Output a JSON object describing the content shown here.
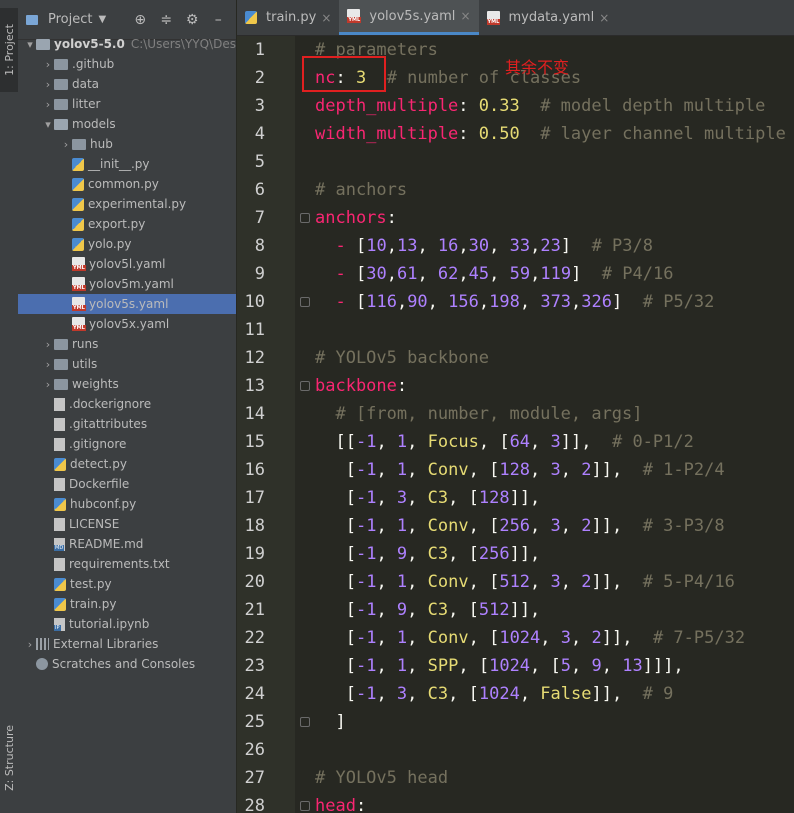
{
  "side_strip": {
    "project_tab": "1: Project",
    "structure_tab": "Z: Structure"
  },
  "panel": {
    "title": "Project"
  },
  "tree": [
    {
      "depth": 0,
      "arrow": "▾",
      "icon": "folder open",
      "label": "yolov5-5.0",
      "bold": true,
      "extra": "C:\\Users\\YYQ\\Des"
    },
    {
      "depth": 1,
      "arrow": "›",
      "icon": "folder",
      "label": ".github"
    },
    {
      "depth": 1,
      "arrow": "›",
      "icon": "folder",
      "label": "data"
    },
    {
      "depth": 1,
      "arrow": "›",
      "icon": "folder",
      "label": "litter"
    },
    {
      "depth": 1,
      "arrow": "▾",
      "icon": "folder open",
      "label": "models"
    },
    {
      "depth": 2,
      "arrow": "›",
      "icon": "folder",
      "label": "hub"
    },
    {
      "depth": 2,
      "arrow": "",
      "icon": "py",
      "label": "__init__.py"
    },
    {
      "depth": 2,
      "arrow": "",
      "icon": "py",
      "label": "common.py"
    },
    {
      "depth": 2,
      "arrow": "",
      "icon": "py",
      "label": "experimental.py"
    },
    {
      "depth": 2,
      "arrow": "",
      "icon": "py",
      "label": "export.py"
    },
    {
      "depth": 2,
      "arrow": "",
      "icon": "py",
      "label": "yolo.py"
    },
    {
      "depth": 2,
      "arrow": "",
      "icon": "yml",
      "label": "yolov5l.yaml"
    },
    {
      "depth": 2,
      "arrow": "",
      "icon": "yml",
      "label": "yolov5m.yaml"
    },
    {
      "depth": 2,
      "arrow": "",
      "icon": "yml",
      "label": "yolov5s.yaml",
      "selected": true
    },
    {
      "depth": 2,
      "arrow": "",
      "icon": "yml",
      "label": "yolov5x.yaml"
    },
    {
      "depth": 1,
      "arrow": "›",
      "icon": "folder",
      "label": "runs"
    },
    {
      "depth": 1,
      "arrow": "›",
      "icon": "folder",
      "label": "utils"
    },
    {
      "depth": 1,
      "arrow": "›",
      "icon": "folder",
      "label": "weights"
    },
    {
      "depth": 1,
      "arrow": "",
      "icon": "txt",
      "label": ".dockerignore"
    },
    {
      "depth": 1,
      "arrow": "",
      "icon": "txt",
      "label": ".gitattributes"
    },
    {
      "depth": 1,
      "arrow": "",
      "icon": "txt",
      "label": ".gitignore"
    },
    {
      "depth": 1,
      "arrow": "",
      "icon": "py",
      "label": "detect.py"
    },
    {
      "depth": 1,
      "arrow": "",
      "icon": "docker",
      "label": "Dockerfile"
    },
    {
      "depth": 1,
      "arrow": "",
      "icon": "py",
      "label": "hubconf.py"
    },
    {
      "depth": 1,
      "arrow": "",
      "icon": "txt",
      "label": "LICENSE"
    },
    {
      "depth": 1,
      "arrow": "",
      "icon": "md",
      "label": "README.md"
    },
    {
      "depth": 1,
      "arrow": "",
      "icon": "txt",
      "label": "requirements.txt"
    },
    {
      "depth": 1,
      "arrow": "",
      "icon": "py",
      "label": "test.py"
    },
    {
      "depth": 1,
      "arrow": "",
      "icon": "py",
      "label": "train.py"
    },
    {
      "depth": 1,
      "arrow": "",
      "icon": "nb",
      "label": "tutorial.ipynb"
    },
    {
      "depth": 0,
      "arrow": "›",
      "icon": "lib",
      "label": "External Libraries"
    },
    {
      "depth": 0,
      "arrow": "",
      "icon": "scratch",
      "label": "Scratches and Consoles"
    }
  ],
  "tabs": [
    {
      "label": "train.py",
      "icon": "py",
      "active": false
    },
    {
      "label": "yolov5s.yaml",
      "icon": "yml",
      "active": true
    },
    {
      "label": "mydata.yaml",
      "icon": "yml",
      "active": false
    }
  ],
  "annotation": "其余不变",
  "code_lines": [
    [
      [
        "c",
        "# parameters"
      ]
    ],
    [
      [
        "k",
        "nc"
      ],
      [
        "w",
        ": "
      ],
      [
        "num",
        "3"
      ],
      [
        "c",
        "  # number of classes"
      ]
    ],
    [
      [
        "k",
        "depth_multiple"
      ],
      [
        "w",
        ": "
      ],
      [
        "num",
        "0.33"
      ],
      [
        "c",
        "  # model depth multiple"
      ]
    ],
    [
      [
        "k",
        "width_multiple"
      ],
      [
        "w",
        ": "
      ],
      [
        "num",
        "0.50"
      ],
      [
        "c",
        "  # layer channel multiple"
      ]
    ],
    [],
    [
      [
        "c",
        "# anchors"
      ]
    ],
    [
      [
        "k",
        "anchors"
      ],
      [
        "w",
        ":"
      ]
    ],
    [
      [
        "w",
        "  "
      ],
      [
        "k",
        "-"
      ],
      [
        "w",
        " ["
      ],
      [
        "lit",
        "10"
      ],
      [
        "w",
        ","
      ],
      [
        "lit",
        "13"
      ],
      [
        "w",
        ", "
      ],
      [
        "lit",
        "16"
      ],
      [
        "w",
        ","
      ],
      [
        "lit",
        "30"
      ],
      [
        "w",
        ", "
      ],
      [
        "lit",
        "33"
      ],
      [
        "w",
        ","
      ],
      [
        "lit",
        "23"
      ],
      [
        "w",
        "]  "
      ],
      [
        "c",
        "# P3/8"
      ]
    ],
    [
      [
        "w",
        "  "
      ],
      [
        "k",
        "-"
      ],
      [
        "w",
        " ["
      ],
      [
        "lit",
        "30"
      ],
      [
        "w",
        ","
      ],
      [
        "lit",
        "61"
      ],
      [
        "w",
        ", "
      ],
      [
        "lit",
        "62"
      ],
      [
        "w",
        ","
      ],
      [
        "lit",
        "45"
      ],
      [
        "w",
        ", "
      ],
      [
        "lit",
        "59"
      ],
      [
        "w",
        ","
      ],
      [
        "lit",
        "119"
      ],
      [
        "w",
        "]  "
      ],
      [
        "c",
        "# P4/16"
      ]
    ],
    [
      [
        "w",
        "  "
      ],
      [
        "k",
        "-"
      ],
      [
        "w",
        " ["
      ],
      [
        "lit",
        "116"
      ],
      [
        "w",
        ","
      ],
      [
        "lit",
        "90"
      ],
      [
        "w",
        ", "
      ],
      [
        "lit",
        "156"
      ],
      [
        "w",
        ","
      ],
      [
        "lit",
        "198"
      ],
      [
        "w",
        ", "
      ],
      [
        "lit",
        "373"
      ],
      [
        "w",
        ","
      ],
      [
        "lit",
        "326"
      ],
      [
        "w",
        "]  "
      ],
      [
        "c",
        "# P5/32"
      ]
    ],
    [],
    [
      [
        "c",
        "# YOLOv5 backbone"
      ]
    ],
    [
      [
        "k",
        "backbone"
      ],
      [
        "w",
        ":"
      ]
    ],
    [
      [
        "c",
        "  # [from, number, module, args]"
      ]
    ],
    [
      [
        "w",
        "  [["
      ],
      [
        "lit",
        "-1"
      ],
      [
        "w",
        ", "
      ],
      [
        "lit",
        "1"
      ],
      [
        "w",
        ", "
      ],
      [
        "n",
        "Focus"
      ],
      [
        "w",
        ", ["
      ],
      [
        "lit",
        "64"
      ],
      [
        "w",
        ", "
      ],
      [
        "lit",
        "3"
      ],
      [
        "w",
        "]],  "
      ],
      [
        "c",
        "# 0-P1/2"
      ]
    ],
    [
      [
        "w",
        "   ["
      ],
      [
        "lit",
        "-1"
      ],
      [
        "w",
        ", "
      ],
      [
        "lit",
        "1"
      ],
      [
        "w",
        ", "
      ],
      [
        "n",
        "Conv"
      ],
      [
        "w",
        ", ["
      ],
      [
        "lit",
        "128"
      ],
      [
        "w",
        ", "
      ],
      [
        "lit",
        "3"
      ],
      [
        "w",
        ", "
      ],
      [
        "lit",
        "2"
      ],
      [
        "w",
        "]],  "
      ],
      [
        "c",
        "# 1-P2/4"
      ]
    ],
    [
      [
        "w",
        "   ["
      ],
      [
        "lit",
        "-1"
      ],
      [
        "w",
        ", "
      ],
      [
        "lit",
        "3"
      ],
      [
        "w",
        ", "
      ],
      [
        "n",
        "C3"
      ],
      [
        "w",
        ", ["
      ],
      [
        "lit",
        "128"
      ],
      [
        "w",
        "]],"
      ]
    ],
    [
      [
        "w",
        "   ["
      ],
      [
        "lit",
        "-1"
      ],
      [
        "w",
        ", "
      ],
      [
        "lit",
        "1"
      ],
      [
        "w",
        ", "
      ],
      [
        "n",
        "Conv"
      ],
      [
        "w",
        ", ["
      ],
      [
        "lit",
        "256"
      ],
      [
        "w",
        ", "
      ],
      [
        "lit",
        "3"
      ],
      [
        "w",
        ", "
      ],
      [
        "lit",
        "2"
      ],
      [
        "w",
        "]],  "
      ],
      [
        "c",
        "# 3-P3/8"
      ]
    ],
    [
      [
        "w",
        "   ["
      ],
      [
        "lit",
        "-1"
      ],
      [
        "w",
        ", "
      ],
      [
        "lit",
        "9"
      ],
      [
        "w",
        ", "
      ],
      [
        "n",
        "C3"
      ],
      [
        "w",
        ", ["
      ],
      [
        "lit",
        "256"
      ],
      [
        "w",
        "]],"
      ]
    ],
    [
      [
        "w",
        "   ["
      ],
      [
        "lit",
        "-1"
      ],
      [
        "w",
        ", "
      ],
      [
        "lit",
        "1"
      ],
      [
        "w",
        ", "
      ],
      [
        "n",
        "Conv"
      ],
      [
        "w",
        ", ["
      ],
      [
        "lit",
        "512"
      ],
      [
        "w",
        ", "
      ],
      [
        "lit",
        "3"
      ],
      [
        "w",
        ", "
      ],
      [
        "lit",
        "2"
      ],
      [
        "w",
        "]],  "
      ],
      [
        "c",
        "# 5-P4/16"
      ]
    ],
    [
      [
        "w",
        "   ["
      ],
      [
        "lit",
        "-1"
      ],
      [
        "w",
        ", "
      ],
      [
        "lit",
        "9"
      ],
      [
        "w",
        ", "
      ],
      [
        "n",
        "C3"
      ],
      [
        "w",
        ", ["
      ],
      [
        "lit",
        "512"
      ],
      [
        "w",
        "]],"
      ]
    ],
    [
      [
        "w",
        "   ["
      ],
      [
        "lit",
        "-1"
      ],
      [
        "w",
        ", "
      ],
      [
        "lit",
        "1"
      ],
      [
        "w",
        ", "
      ],
      [
        "n",
        "Conv"
      ],
      [
        "w",
        ", ["
      ],
      [
        "lit",
        "1024"
      ],
      [
        "w",
        ", "
      ],
      [
        "lit",
        "3"
      ],
      [
        "w",
        ", "
      ],
      [
        "lit",
        "2"
      ],
      [
        "w",
        "]],  "
      ],
      [
        "c",
        "# 7-P5/32"
      ]
    ],
    [
      [
        "w",
        "   ["
      ],
      [
        "lit",
        "-1"
      ],
      [
        "w",
        ", "
      ],
      [
        "lit",
        "1"
      ],
      [
        "w",
        ", "
      ],
      [
        "n",
        "SPP"
      ],
      [
        "w",
        ", ["
      ],
      [
        "lit",
        "1024"
      ],
      [
        "w",
        ", ["
      ],
      [
        "lit",
        "5"
      ],
      [
        "w",
        ", "
      ],
      [
        "lit",
        "9"
      ],
      [
        "w",
        ", "
      ],
      [
        "lit",
        "13"
      ],
      [
        "w",
        "]]],"
      ]
    ],
    [
      [
        "w",
        "   ["
      ],
      [
        "lit",
        "-1"
      ],
      [
        "w",
        ", "
      ],
      [
        "lit",
        "3"
      ],
      [
        "w",
        ", "
      ],
      [
        "n",
        "C3"
      ],
      [
        "w",
        ", ["
      ],
      [
        "lit",
        "1024"
      ],
      [
        "w",
        ", "
      ],
      [
        "n",
        "False"
      ],
      [
        "w",
        "]],  "
      ],
      [
        "c",
        "# 9"
      ]
    ],
    [
      [
        "w",
        "  ]"
      ]
    ],
    [],
    [
      [
        "c",
        "# YOLOv5 head"
      ]
    ],
    [
      [
        "k",
        "head"
      ],
      [
        "w",
        ":"
      ]
    ]
  ]
}
